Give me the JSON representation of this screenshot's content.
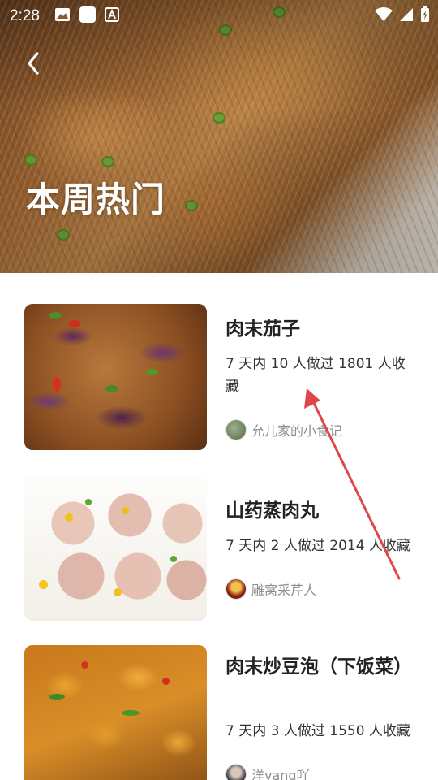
{
  "status_bar": {
    "time": "2:28",
    "icons": [
      "image-icon",
      "square-icon",
      "font-icon",
      "wifi-icon",
      "signal-icon",
      "battery-charging-icon"
    ]
  },
  "header": {
    "back_icon": "chevron-left-icon",
    "title": "本周热门"
  },
  "recipes": [
    {
      "title": "肉末茄子",
      "stats": "7 天内 10 人做过 1801 人收藏",
      "author": "允儿家的小食记"
    },
    {
      "title": "山药蒸肉丸",
      "stats": "7 天内 2 人做过 2014 人收藏",
      "author": "雕窝采芹人"
    },
    {
      "title": "肉末炒豆泡（下饭菜）",
      "stats": "7 天内 3 人做过 1550 人收藏",
      "author": "洋yang吖"
    }
  ],
  "colors": {
    "title_text": "#222222",
    "stats_text": "#333333",
    "author_text": "#8e8e8e",
    "annotation_arrow": "#e0454a"
  }
}
